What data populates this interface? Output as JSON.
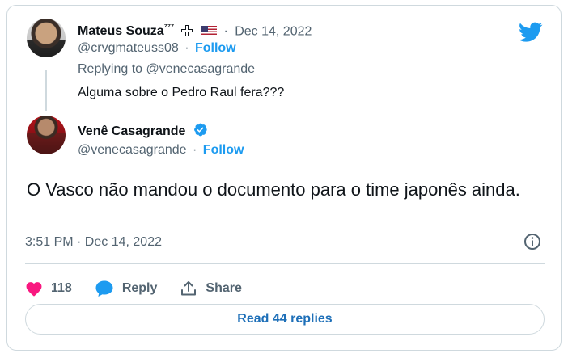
{
  "reply_tweet": {
    "author_name": "Mateus Souza",
    "author_name_suffix": "⁷⁷⁷",
    "handle": "@crvgmateuss08",
    "separator": "·",
    "date": "Dec 14, 2022",
    "follow_label": "Follow",
    "replying_prefix": "Replying to ",
    "replying_to": "@venecasagrande",
    "text": "Alguma sobre o Pedro Raul fera???"
  },
  "main_tweet": {
    "author_name": "Venê Casagrande",
    "handle": "@venecasagrande",
    "separator": "·",
    "follow_label": "Follow",
    "text": "O Vasco não mandou o documento para o time japonês ainda.",
    "timestamp": "3:51 PM · Dec 14, 2022"
  },
  "actions": {
    "like_count": "118",
    "reply_label": "Reply",
    "share_label": "Share"
  },
  "read_replies_label": "Read 44 replies",
  "colors": {
    "accent": "#1d9bf0",
    "like": "#f91880",
    "muted": "#536471",
    "border": "#cfd9de"
  },
  "icons": [
    "twitter-bird-icon",
    "verified-badge-icon",
    "info-icon",
    "heart-icon",
    "reply-bubble-icon",
    "share-icon"
  ]
}
